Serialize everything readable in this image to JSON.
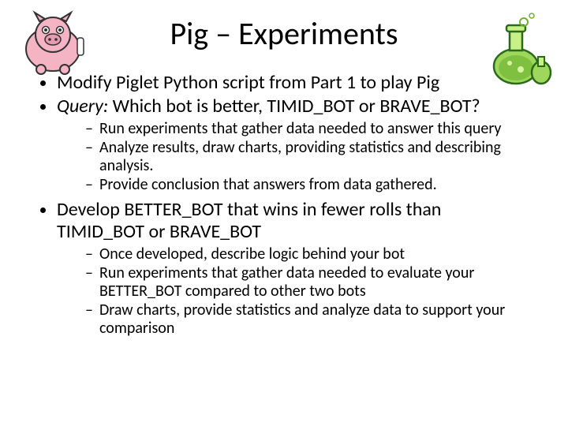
{
  "title": "Pig – Experiments",
  "bullets": {
    "b1": "Modify Piglet Python script from Part 1 to play Pig",
    "b2_prefix": "Query:",
    "b2_rest": " Which bot is better, TIMID_BOT or BRAVE_BOT?",
    "b2_sub": {
      "s1": "Run experiments that gather data needed to answer this query",
      "s2": "Analyze results, draw charts, providing statistics and describing analysis.",
      "s3": "Provide conclusion that answers from data gathered."
    },
    "b3": "Develop BETTER_BOT that wins in fewer rolls than TIMID_BOT or BRAVE_BOT",
    "b3_sub": {
      "s1": "Once developed, describe logic behind your bot",
      "s2": "Run experiments that gather data needed to evaluate your BETTER_BOT compared to other two bots",
      "s3": "Draw charts, provide statistics and analyze data to support your comparison"
    }
  }
}
